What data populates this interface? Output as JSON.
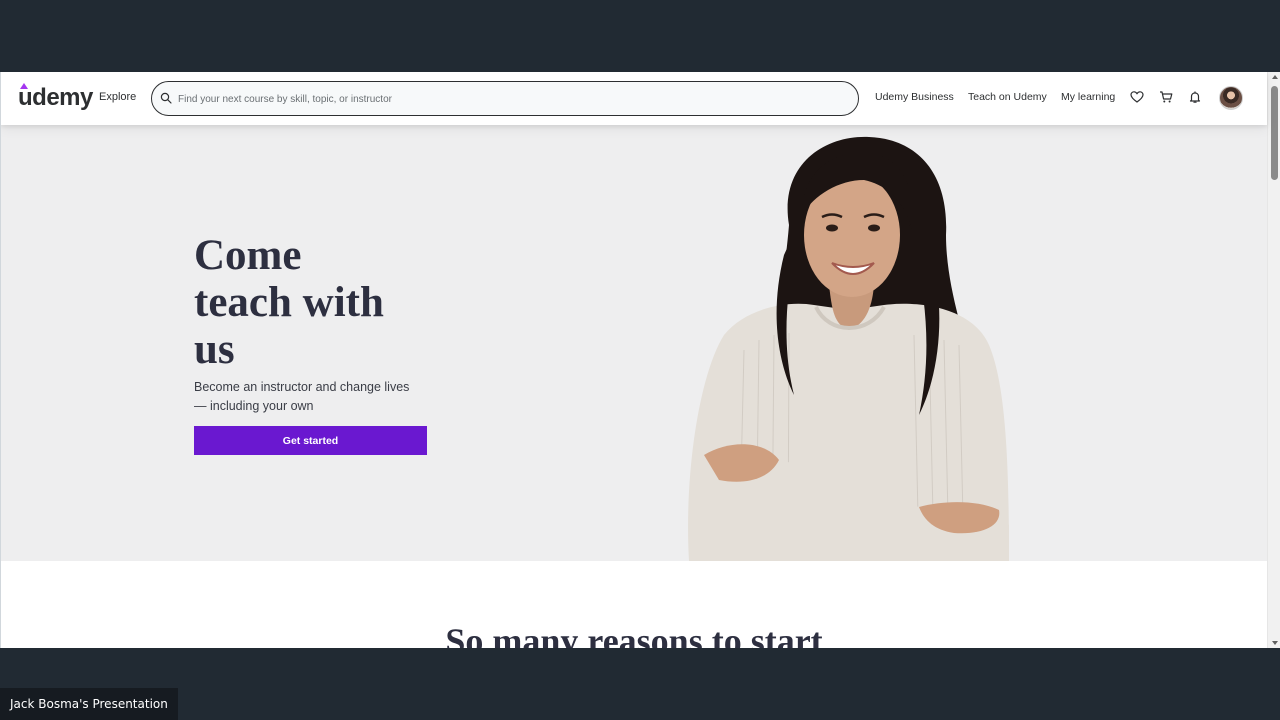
{
  "header": {
    "logo_text": "udemy",
    "explore_label": "Explore",
    "search_placeholder": "Find your next course by skill, topic, or instructor",
    "nav": {
      "business": "Udemy Business",
      "teach": "Teach on Udemy",
      "learning": "My learning"
    },
    "icons": [
      "heart-icon",
      "cart-icon",
      "bell-icon"
    ]
  },
  "hero": {
    "title_lines": [
      "Come",
      "teach with",
      "us"
    ],
    "subtitle_lines": [
      "Become an instructor and change lives",
      "— including your own"
    ],
    "cta_label": "Get started"
  },
  "lower": {
    "title": "So many reasons to start"
  },
  "presenter": {
    "label": "Jack Bosma's Presentation"
  },
  "colors": {
    "accent": "#6a18d0",
    "hero_bg": "#eeeeef",
    "frame_bg": "#212a33"
  }
}
